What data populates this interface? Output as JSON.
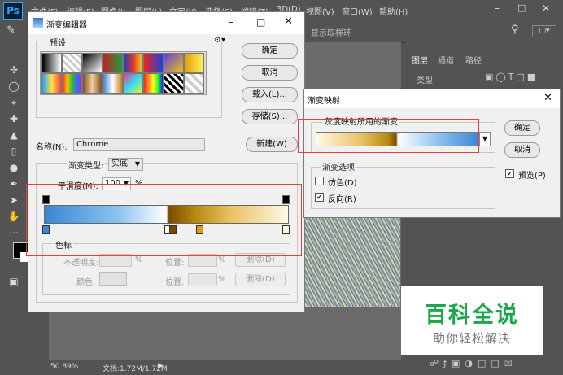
{
  "app": {
    "logo": "Ps",
    "menus": [
      "文件(F)",
      "编辑(E)",
      "图像(I)",
      "图层(L)",
      "文字(Y)",
      "选择(S)",
      "滤镜(T)",
      "3D(D)",
      "视图(V)",
      "窗口(W)",
      "帮助(H)"
    ],
    "options_text": "显示取样环"
  },
  "status": {
    "zoom": "50.89%",
    "doc": "文档:1.72M/1.72M"
  },
  "panels": {
    "tabs": [
      "图层",
      "通道",
      "路径"
    ],
    "kind_filter": "类型"
  },
  "gradient_editor": {
    "title": "渐变编辑器",
    "presets_label": "预设",
    "buttons": {
      "ok": "确定",
      "cancel": "取消",
      "load": "载入(L)...",
      "save": "存储(S)...",
      "new": "新建(W)"
    },
    "name_label": "名称(N):",
    "name_value": "Chrome",
    "type_label": "渐变类型:",
    "type_value": "实底",
    "smooth_label": "平滑度(M):",
    "smooth_value": "100",
    "smooth_unit": "%",
    "stops_group": "色标",
    "opacity_label": "不透明度:",
    "location_label": "位置:",
    "percent": "%",
    "delete_label": "删除(D)",
    "color_label": "颜色:"
  },
  "gradient_map": {
    "title": "渐变映射",
    "group_label": "灰度映射所用的渐变",
    "buttons": {
      "ok": "确定",
      "cancel": "取消"
    },
    "options_label": "渐变选项",
    "dither": "仿色(D)",
    "reverse": "反向(R)",
    "preview": "预览(P)",
    "dither_checked": false,
    "reverse_checked": true,
    "preview_checked": true
  },
  "watermark": {
    "title": "百科全说",
    "subtitle": "助你轻松解决"
  },
  "colors": {
    "ps_dark": "#535353",
    "accent_blue": "#31a8ff",
    "red_highlight": "#e04040",
    "watermark_green": "#1aa84a"
  }
}
